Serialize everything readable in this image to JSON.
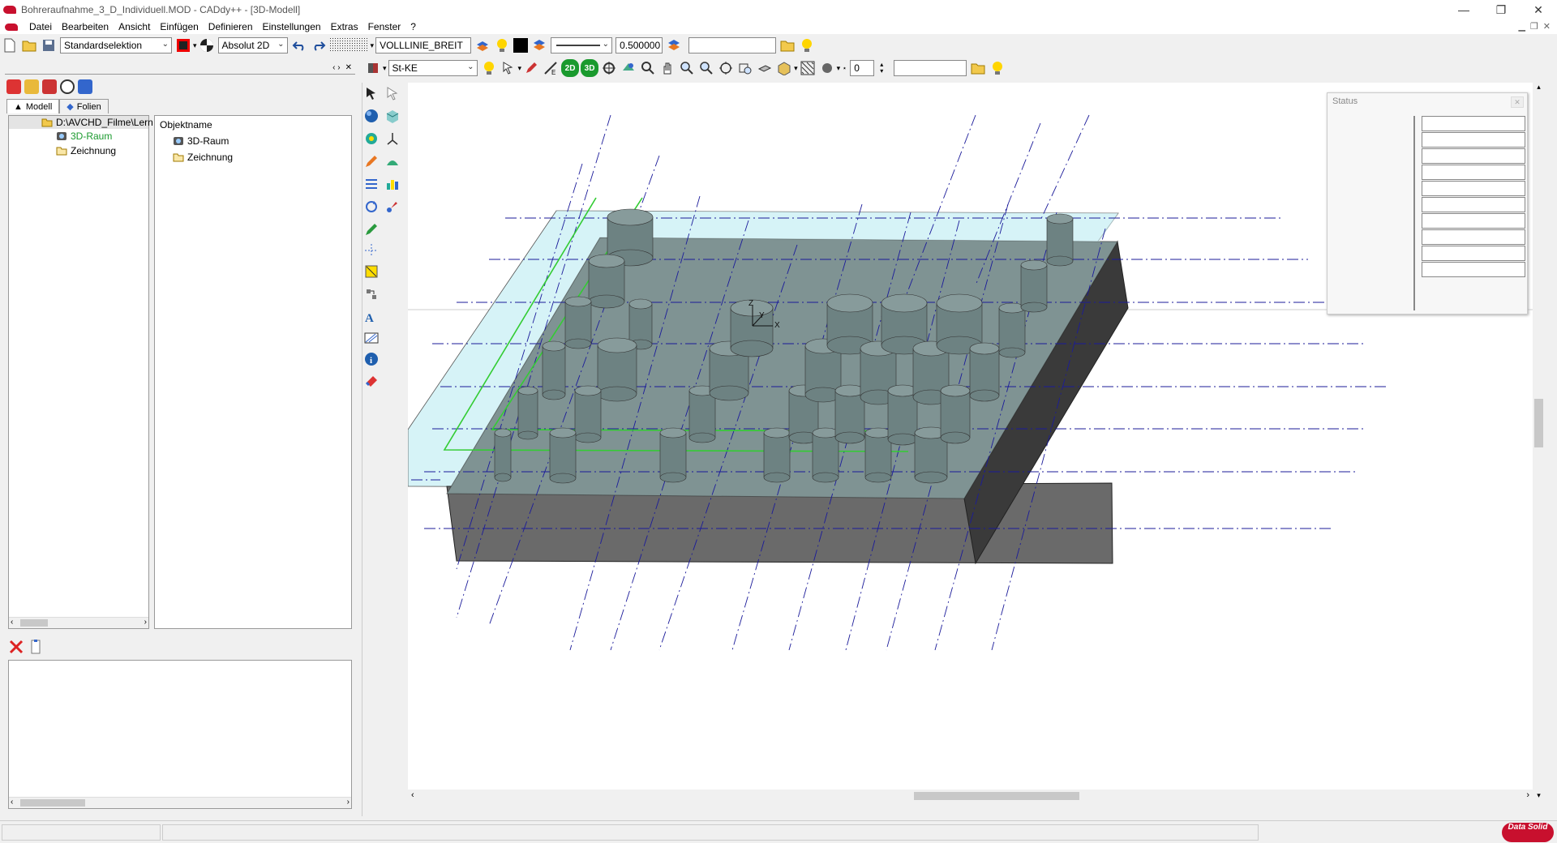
{
  "window": {
    "title": "Bohreraufnahme_3_D_Individuell.MOD  -  CADdy++ - [3D-Modell]",
    "controls": [
      "—",
      "❐",
      "✕"
    ]
  },
  "menu": [
    "Datei",
    "Bearbeiten",
    "Ansicht",
    "Einfügen",
    "Definieren",
    "Einstellungen",
    "Extras",
    "Fenster",
    "?"
  ],
  "toolbar1": {
    "selection_mode": "Standardselektion",
    "coord_mode": "Absolut 2D",
    "linetype": "VOLLLINIE_BREIT",
    "line_width": "0.500000",
    "text_field": ""
  },
  "toolbar2": {
    "material": "St-KE",
    "layer_number": "0",
    "btn_2d": "2D",
    "btn_3d": "3D",
    "text_field": ""
  },
  "left_panel": {
    "tabs": [
      "Modell",
      "Folien"
    ],
    "tree": [
      {
        "label": "D:\\AVCHD_Filme\\Lern",
        "type": "folder-open"
      },
      {
        "label": "3D-Raum",
        "type": "space",
        "highlight": true
      },
      {
        "label": "Zeichnung",
        "type": "folder"
      }
    ],
    "object_list": {
      "header": "Objektname",
      "items": [
        "3D-Raum",
        "Zeichnung"
      ]
    }
  },
  "status_panel": {
    "title": "Status",
    "rows": 10
  },
  "statusbar": {
    "logo": "Data Solid"
  },
  "colors": {
    "accent": "#c8102e",
    "plate_top": "#7f9393",
    "plate_side": "#6a6a6a",
    "plate_dark": "#3a3a3a",
    "plane": "#d6f3f7",
    "axis_lines": "#1b1b9a",
    "selection_lines": "#33cc33"
  }
}
